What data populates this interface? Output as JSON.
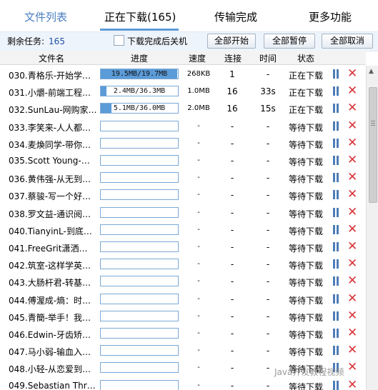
{
  "tabs": [
    {
      "label": "文件列表"
    },
    {
      "label": "正在下载(165)"
    },
    {
      "label": "传输完成"
    },
    {
      "label": "更多功能"
    }
  ],
  "toolbar": {
    "remaining_label": "剩余任务:",
    "remaining_count": "165",
    "shutdown_label": "下载完成后关机",
    "start_all": "全部开始",
    "pause_all": "全部暂停",
    "cancel_all": "全部取消"
  },
  "columns": {
    "name": "文件名",
    "progress": "进度",
    "speed": "速度",
    "connections": "连接",
    "time": "时间",
    "status": "状态"
  },
  "rows": [
    {
      "name": "030.青格乐-开始学…",
      "progress_text": "19.5MB/19.7MB",
      "progress": 0.99,
      "speed": "268KB",
      "conn": "1",
      "time": "-",
      "status": "正在下载"
    },
    {
      "name": "031.小爝-前端工程…",
      "progress_text": "2.4MB/36.3MB",
      "progress": 0.07,
      "speed": "1.0MB",
      "conn": "16",
      "time": "33s",
      "status": "正在下载"
    },
    {
      "name": "032.SunLau-网购家…",
      "progress_text": "5.1MB/36.0MB",
      "progress": 0.14,
      "speed": "2.0MB",
      "conn": "16",
      "time": "15s",
      "status": "正在下载"
    },
    {
      "name": "033.李笑来-人人都…",
      "progress_text": "",
      "progress": 0,
      "speed": "-",
      "conn": "-",
      "time": "-",
      "status": "等待下载"
    },
    {
      "name": "034.麦煥同学-带你…",
      "progress_text": "",
      "progress": 0,
      "speed": "-",
      "conn": "-",
      "time": "-",
      "status": "等待下载"
    },
    {
      "name": "035.Scott Young-…",
      "progress_text": "",
      "progress": 0,
      "speed": "-",
      "conn": "-",
      "time": "-",
      "status": "等待下载"
    },
    {
      "name": "036.黄伟强-从无到…",
      "progress_text": "",
      "progress": 0,
      "speed": "-",
      "conn": "-",
      "time": "-",
      "status": "等待下载"
    },
    {
      "name": "037.蔡骏-写一个好…",
      "progress_text": "",
      "progress": 0,
      "speed": "-",
      "conn": "-",
      "time": "-",
      "status": "等待下载"
    },
    {
      "name": "038.罗文益-通识阅…",
      "progress_text": "",
      "progress": 0,
      "speed": "-",
      "conn": "-",
      "time": "-",
      "status": "等待下载"
    },
    {
      "name": "040.TianyinL-到底…",
      "progress_text": "",
      "progress": 0,
      "speed": "-",
      "conn": "-",
      "time": "-",
      "status": "等待下载"
    },
    {
      "name": "041.FreeGrit潇洒…",
      "progress_text": "",
      "progress": 0,
      "speed": "-",
      "conn": "-",
      "time": "-",
      "status": "等待下载"
    },
    {
      "name": "042.筑室-这样学英…",
      "progress_text": "",
      "progress": 0,
      "speed": "-",
      "conn": "-",
      "time": "-",
      "status": "等待下载"
    },
    {
      "name": "043.大肠杆君-转基…",
      "progress_text": "",
      "progress": 0,
      "speed": "-",
      "conn": "-",
      "time": "-",
      "status": "等待下载"
    },
    {
      "name": "044.傅渥成-熵：时…",
      "progress_text": "",
      "progress": 0,
      "speed": "-",
      "conn": "-",
      "time": "-",
      "status": "等待下载"
    },
    {
      "name": "045.青簡-举手！我…",
      "progress_text": "",
      "progress": 0,
      "speed": "-",
      "conn": "-",
      "time": "-",
      "status": "等待下载"
    },
    {
      "name": "046.Edwin-牙齿矫…",
      "progress_text": "",
      "progress": 0,
      "speed": "-",
      "conn": "-",
      "time": "-",
      "status": "等待下载"
    },
    {
      "name": "047.马小弱-输血入…",
      "progress_text": "",
      "progress": 0,
      "speed": "-",
      "conn": "-",
      "time": "-",
      "status": "等待下载"
    },
    {
      "name": "048.小轻-从恋爱到…",
      "progress_text": "",
      "progress": 0,
      "speed": "-",
      "conn": "-",
      "time": "-",
      "status": "等待下载"
    },
    {
      "name": "049.Sebastian Thr…",
      "progress_text": "",
      "progress": 0,
      "speed": "-",
      "conn": "-",
      "time": "-",
      "status": "等待下载"
    }
  ],
  "watermark": "Java开发教程视频"
}
